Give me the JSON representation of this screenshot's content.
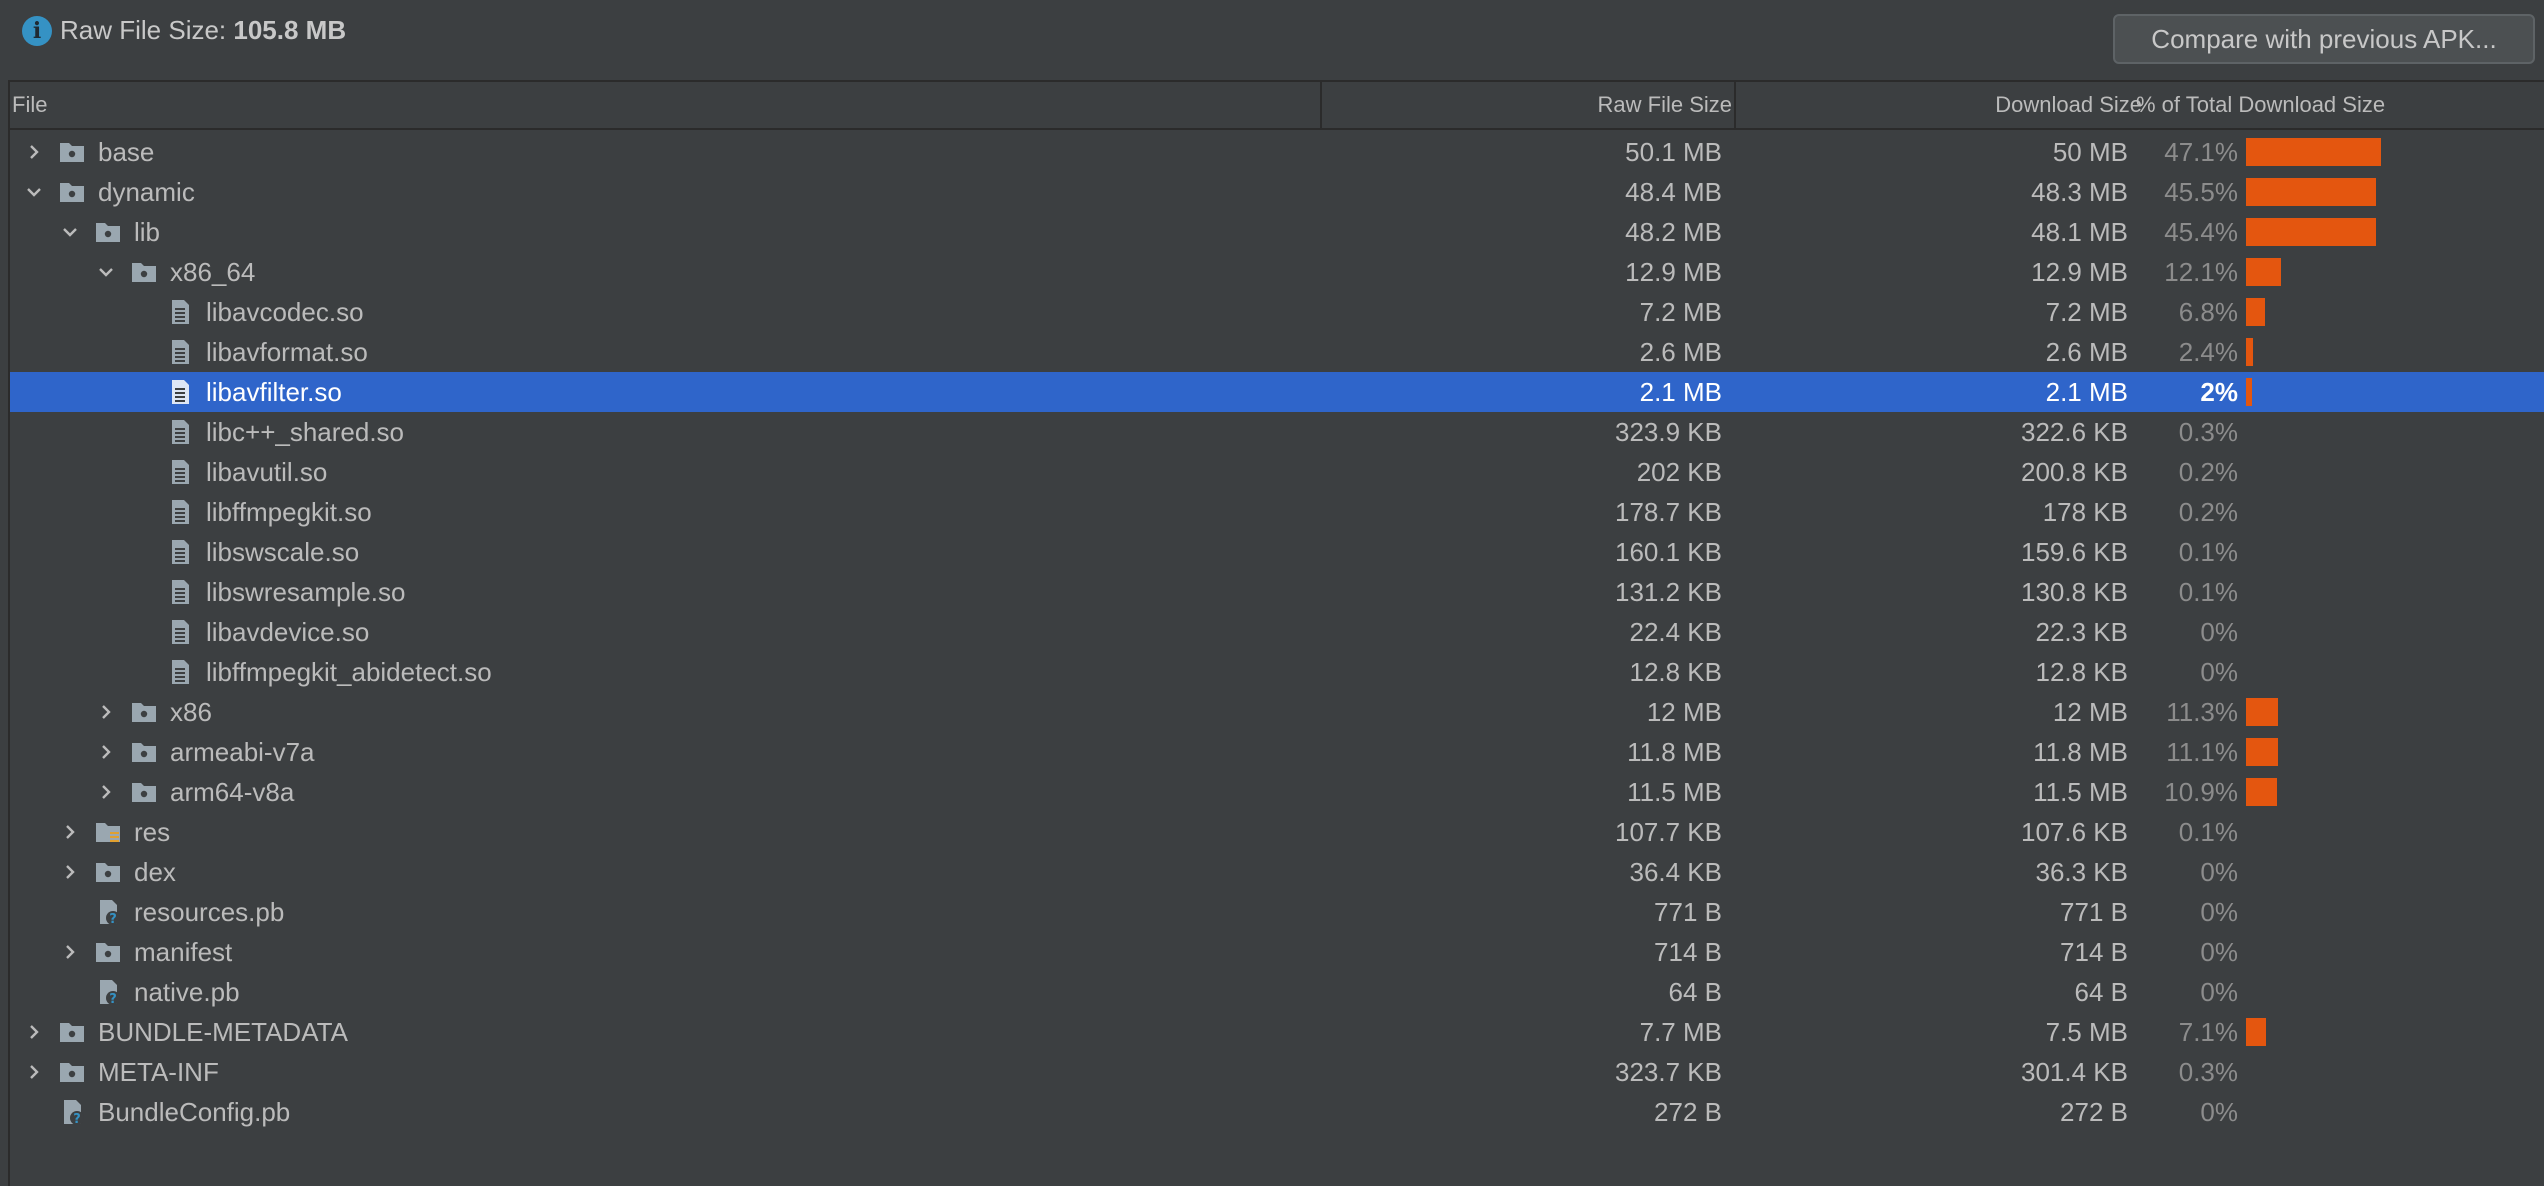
{
  "header": {
    "raw_label": "Raw File Size:",
    "raw_value": "105.8 MB",
    "compare_button": "Compare with previous APK..."
  },
  "columns": {
    "file": "File",
    "raw": "Raw File Size",
    "download": "Download Size",
    "percent": "% of Total Download Size"
  },
  "colors": {
    "background": "#3c3f41",
    "selection": "#2f65ca",
    "bar": "#e4560f",
    "folder_icon": "#9aa7b0",
    "file_icon": "#9aa7b0",
    "info_icon": "#3592c4"
  },
  "rows": [
    {
      "name": "base",
      "raw": "50.1 MB",
      "download": "50 MB",
      "percent": "47.1%",
      "share": 0.471,
      "depth": 0,
      "expander": "collapsed",
      "icon": "folder-icon"
    },
    {
      "name": "dynamic",
      "raw": "48.4 MB",
      "download": "48.3 MB",
      "percent": "45.5%",
      "share": 0.455,
      "depth": 0,
      "expander": "expanded",
      "icon": "folder-icon"
    },
    {
      "name": "lib",
      "raw": "48.2 MB",
      "download": "48.1 MB",
      "percent": "45.4%",
      "share": 0.454,
      "depth": 1,
      "expander": "expanded",
      "icon": "folder-icon"
    },
    {
      "name": "x86_64",
      "raw": "12.9 MB",
      "download": "12.9 MB",
      "percent": "12.1%",
      "share": 0.121,
      "depth": 2,
      "expander": "expanded",
      "icon": "folder-icon"
    },
    {
      "name": "libavcodec.so",
      "raw": "7.2 MB",
      "download": "7.2 MB",
      "percent": "6.8%",
      "share": 0.068,
      "depth": 3,
      "expander": "none",
      "icon": "file-icon"
    },
    {
      "name": "libavformat.so",
      "raw": "2.6 MB",
      "download": "2.6 MB",
      "percent": "2.4%",
      "share": 0.024,
      "depth": 3,
      "expander": "none",
      "icon": "file-icon"
    },
    {
      "name": "libavfilter.so",
      "raw": "2.1 MB",
      "download": "2.1 MB",
      "percent": "2%",
      "share": 0.02,
      "depth": 3,
      "expander": "none",
      "icon": "file-icon",
      "selected": true
    },
    {
      "name": "libc++_shared.so",
      "raw": "323.9 KB",
      "download": "322.6 KB",
      "percent": "0.3%",
      "share": 0.003,
      "depth": 3,
      "expander": "none",
      "icon": "file-icon"
    },
    {
      "name": "libavutil.so",
      "raw": "202 KB",
      "download": "200.8 KB",
      "percent": "0.2%",
      "share": 0.002,
      "depth": 3,
      "expander": "none",
      "icon": "file-icon"
    },
    {
      "name": "libffmpegkit.so",
      "raw": "178.7 KB",
      "download": "178 KB",
      "percent": "0.2%",
      "share": 0.002,
      "depth": 3,
      "expander": "none",
      "icon": "file-icon"
    },
    {
      "name": "libswscale.so",
      "raw": "160.1 KB",
      "download": "159.6 KB",
      "percent": "0.1%",
      "share": 0.001,
      "depth": 3,
      "expander": "none",
      "icon": "file-icon"
    },
    {
      "name": "libswresample.so",
      "raw": "131.2 KB",
      "download": "130.8 KB",
      "percent": "0.1%",
      "share": 0.001,
      "depth": 3,
      "expander": "none",
      "icon": "file-icon"
    },
    {
      "name": "libavdevice.so",
      "raw": "22.4 KB",
      "download": "22.3 KB",
      "percent": "0%",
      "share": 0,
      "depth": 3,
      "expander": "none",
      "icon": "file-icon"
    },
    {
      "name": "libffmpegkit_abidetect.so",
      "raw": "12.8 KB",
      "download": "12.8 KB",
      "percent": "0%",
      "share": 0,
      "depth": 3,
      "expander": "none",
      "icon": "file-icon"
    },
    {
      "name": "x86",
      "raw": "12 MB",
      "download": "12 MB",
      "percent": "11.3%",
      "share": 0.113,
      "depth": 2,
      "expander": "collapsed",
      "icon": "folder-icon"
    },
    {
      "name": "armeabi-v7a",
      "raw": "11.8 MB",
      "download": "11.8 MB",
      "percent": "11.1%",
      "share": 0.111,
      "depth": 2,
      "expander": "collapsed",
      "icon": "folder-icon"
    },
    {
      "name": "arm64-v8a",
      "raw": "11.5 MB",
      "download": "11.5 MB",
      "percent": "10.9%",
      "share": 0.109,
      "depth": 2,
      "expander": "collapsed",
      "icon": "folder-icon"
    },
    {
      "name": "res",
      "raw": "107.7 KB",
      "download": "107.6 KB",
      "percent": "0.1%",
      "share": 0.001,
      "depth": 1,
      "expander": "collapsed",
      "icon": "resource-folder-icon"
    },
    {
      "name": "dex",
      "raw": "36.4 KB",
      "download": "36.3 KB",
      "percent": "0%",
      "share": 0,
      "depth": 1,
      "expander": "collapsed",
      "icon": "folder-icon"
    },
    {
      "name": "resources.pb",
      "raw": "771 B",
      "download": "771 B",
      "percent": "0%",
      "share": 0,
      "depth": 1,
      "expander": "none",
      "icon": "unknown-file-icon"
    },
    {
      "name": "manifest",
      "raw": "714 B",
      "download": "714 B",
      "percent": "0%",
      "share": 0,
      "depth": 1,
      "expander": "collapsed",
      "icon": "folder-icon"
    },
    {
      "name": "native.pb",
      "raw": "64 B",
      "download": "64 B",
      "percent": "0%",
      "share": 0,
      "depth": 1,
      "expander": "none",
      "icon": "unknown-file-icon"
    },
    {
      "name": "BUNDLE-METADATA",
      "raw": "7.7 MB",
      "download": "7.5 MB",
      "percent": "7.1%",
      "share": 0.071,
      "depth": 0,
      "expander": "collapsed",
      "icon": "folder-icon"
    },
    {
      "name": "META-INF",
      "raw": "323.7 KB",
      "download": "301.4 KB",
      "percent": "0.3%",
      "share": 0.003,
      "depth": 0,
      "expander": "collapsed",
      "icon": "folder-icon"
    },
    {
      "name": "BundleConfig.pb",
      "raw": "272 B",
      "download": "272 B",
      "percent": "0%",
      "share": 0,
      "depth": 0,
      "expander": "none",
      "icon": "unknown-file-icon"
    }
  ]
}
